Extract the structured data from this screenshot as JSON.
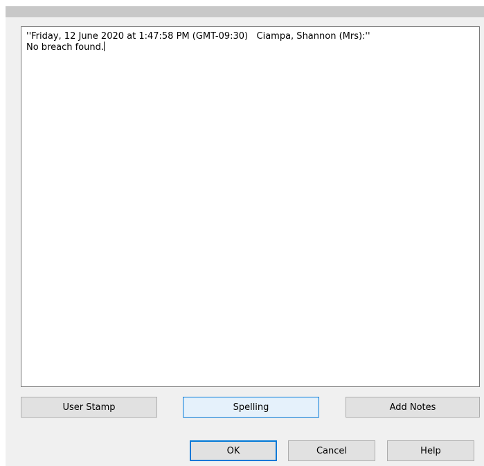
{
  "notes": {
    "line1": "''Friday, 12 June 2020 at 1:47:58 PM (GMT-09:30)   Ciampa, Shannon (Mrs):''",
    "line2": "No breach found."
  },
  "toolbar": {
    "user_stamp_label": "User Stamp",
    "spelling_label": "Spelling",
    "add_notes_label": "Add Notes"
  },
  "footer": {
    "ok_label": "OK",
    "cancel_label": "Cancel",
    "help_label": "Help"
  },
  "colors": {
    "accent": "#0078d7",
    "dialog_bg": "#f0f0f0",
    "button_bg": "#e1e1e1"
  }
}
